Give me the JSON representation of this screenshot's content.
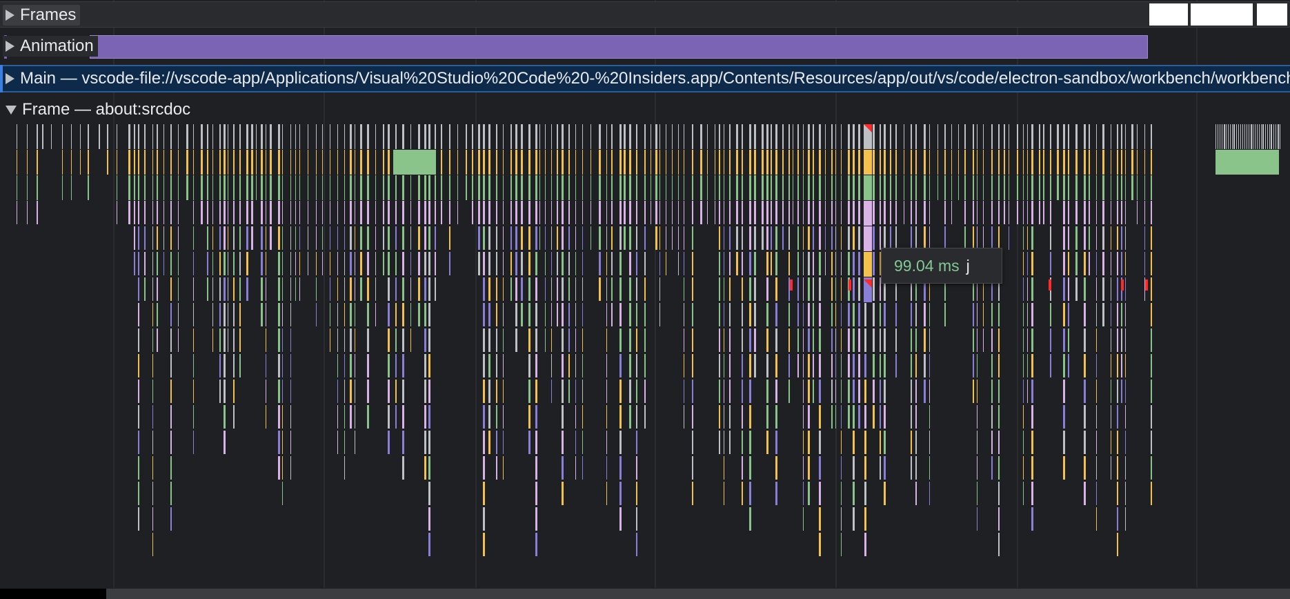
{
  "tracks": {
    "frames": {
      "label": "Frames",
      "icon": "expand-triangle-icon"
    },
    "animation": {
      "label": "Animation",
      "icon": "expand-triangle-icon"
    },
    "main": {
      "label": "Main — vscode-file://vscode-app/Applications/Visual%20Studio%20Code%20-%20Insiders.app/Contents/Resources/app/out/vs/code/electron-sandbox/workbench/workbench.html",
      "icon": "expand-triangle-icon"
    },
    "frame": {
      "label": "Frame — about:srcdoc",
      "icon": "collapse-triangle-icon"
    }
  },
  "tooltip": {
    "duration": "99.04 ms",
    "name": "j"
  },
  "colors": {
    "background": "#1f2023",
    "animation": "#7b64b4",
    "main_bg": "#0e2a4a",
    "task_gray": "#bdc1c6",
    "script_yellow": "#f2c14e",
    "paint_green": "#8bc48a",
    "layout_purple": "#8a7fd6",
    "style_pink": "#d9b3e6",
    "long_task_red": "#ff2a2a",
    "tooltip_ms": "#81c995"
  }
}
